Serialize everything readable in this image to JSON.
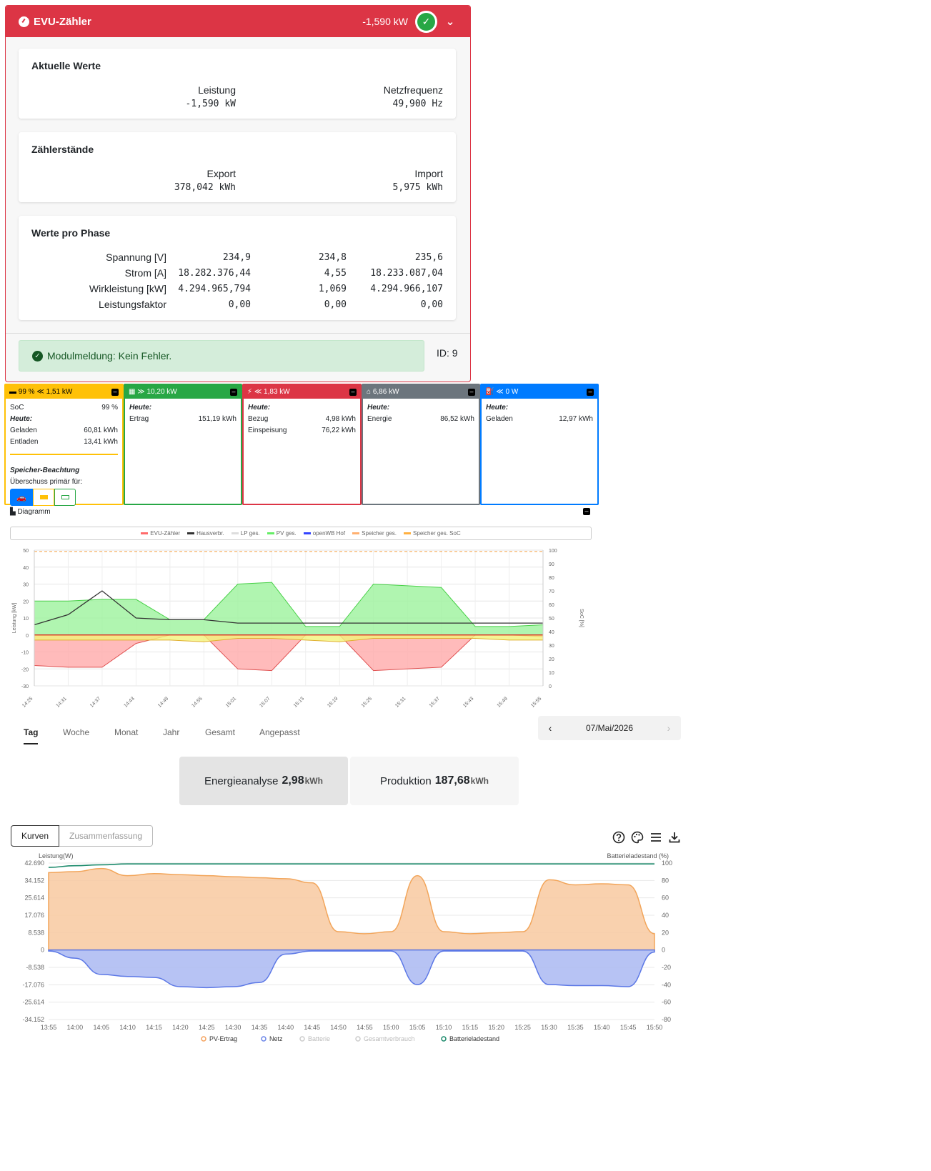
{
  "evu": {
    "title": "EVU-Zähler",
    "power": "-1,590 kW",
    "current": {
      "title": "Aktuelle Werte",
      "leistung_label": "Leistung",
      "leistung_value": "-1,590 kW",
      "freq_label": "Netzfrequenz",
      "freq_value": "49,900 Hz"
    },
    "counters": {
      "title": "Zählerstände",
      "export_label": "Export",
      "export_value": "378,042 kWh",
      "import_label": "Import",
      "import_value": "5,975 kWh"
    },
    "phases": {
      "title": "Werte pro Phase",
      "rows": [
        {
          "label": "Spannung [V]",
          "v": [
            "234,9",
            "234,8",
            "235,6"
          ]
        },
        {
          "label": "Strom [A]",
          "v": [
            "18.282.376,44",
            "4,55",
            "18.233.087,04"
          ]
        },
        {
          "label": "Wirkleistung [kW]",
          "v": [
            "4.294.965,794",
            "1,069",
            "4.294.966,107"
          ]
        },
        {
          "label": "Leistungsfaktor",
          "v": [
            "0,00",
            "0,00",
            "0,00"
          ]
        }
      ]
    },
    "message": "Modulmeldung: Kein Fehler.",
    "id": "ID: 9"
  },
  "status_cards": {
    "battery": {
      "header": "99 % ≪ 1,51 kW",
      "soc_label": "SoC",
      "soc_value": "99 %",
      "today": "Heute:",
      "charged_label": "Geladen",
      "charged_value": "60,81 kWh",
      "discharged_label": "Entladen",
      "discharged_value": "13,41 kWh",
      "note_title": "Speicher-Beachtung",
      "note_text": "Überschuss primär für:"
    },
    "pv": {
      "header": "≫ 10,20 kW",
      "today": "Heute:",
      "yield_label": "Ertrag",
      "yield_value": "151,19 kWh"
    },
    "grid": {
      "header": "≪ 1,83 kW",
      "today": "Heute:",
      "buy_label": "Bezug",
      "buy_value": "4,98 kWh",
      "feed_label": "Einspeisung",
      "feed_value": "76,22 kWh"
    },
    "house": {
      "header": "6,86 kW",
      "today": "Heute:",
      "energy_label": "Energie",
      "energy_value": "86,52 kWh"
    },
    "charge": {
      "header": "≪ 0 W",
      "today": "Heute:",
      "charged_label": "Geladen",
      "charged_value": "12,97 kWh"
    }
  },
  "colors": {
    "evu_red": "#dc3545",
    "battery_yellow": "#ffc107",
    "pv_green": "#28a745",
    "house_gray": "#6c757d",
    "charge_blue": "#007bff"
  },
  "diagram": {
    "title": "Diagramm",
    "legend": [
      "EVU-Zähler",
      "Hausverbr.",
      "LP ges.",
      "PV ges.",
      "openWB Hof",
      "Speicher ges.",
      "Speicher ges. SoC"
    ],
    "legend_colors": [
      "#ff6b6b",
      "#333333",
      "#dddddd",
      "#66ee66",
      "#3344ff",
      "#ffb070",
      "#ffb040"
    ],
    "ylabel_left": "Leistung [kW]",
    "ylabel_right": "SoC [%]",
    "yticks_left": [
      "50",
      "40",
      "30",
      "20",
      "10",
      "0",
      "-10",
      "-20",
      "-30"
    ],
    "yticks_right": [
      "100",
      "90",
      "80",
      "70",
      "60",
      "50",
      "40",
      "30",
      "20",
      "10",
      "0"
    ],
    "xticks": [
      "14:25",
      "14:31",
      "14:37",
      "14:43",
      "14:49",
      "14:55",
      "15:01",
      "15:07",
      "15:13",
      "15:19",
      "15:25",
      "15:31",
      "15:37",
      "15:43",
      "15:49",
      "15:55"
    ]
  },
  "chart_data": [
    {
      "type": "area",
      "ylabel": "Leistung [kW]",
      "ylabel_right": "SoC [%]",
      "ylim": [
        -30,
        50
      ],
      "ylim_right": [
        0,
        100
      ],
      "x": [
        "14:25",
        "14:31",
        "14:37",
        "14:43",
        "14:49",
        "14:55",
        "15:01",
        "15:07",
        "15:13",
        "15:19",
        "15:25",
        "15:31",
        "15:37",
        "15:43",
        "15:49",
        "15:55"
      ],
      "series": [
        {
          "name": "PV ges.",
          "values": [
            20,
            20,
            21,
            21,
            9,
            9,
            30,
            31,
            5,
            5,
            30,
            29,
            28,
            5,
            5,
            6
          ]
        },
        {
          "name": "EVU-Zähler",
          "values": [
            -18,
            -19,
            -19,
            -5,
            0,
            0,
            -20,
            -21,
            0,
            0,
            -21,
            -20,
            -19,
            0,
            0,
            -1
          ]
        },
        {
          "name": "Hausverbr.",
          "values": [
            6,
            12,
            26,
            10,
            9,
            9,
            7,
            7,
            7,
            7,
            7,
            7,
            7,
            7,
            7,
            7
          ]
        },
        {
          "name": "Speicher ges.",
          "values": [
            -3,
            -3,
            -3,
            -3,
            -3,
            -4,
            -2,
            -2,
            -3,
            -4,
            -2,
            -2,
            -2,
            -2,
            -3,
            -3
          ]
        },
        {
          "name": "Speicher ges. SoC",
          "values": [
            99,
            99,
            99,
            99,
            99,
            99,
            99,
            99,
            99,
            99,
            99,
            99,
            99,
            99,
            99,
            99
          ]
        }
      ]
    },
    {
      "type": "area",
      "ylabel": "Leistung(W)",
      "ylabel_right": "Batterieladestand (%)",
      "ylim": [
        -34152,
        42690
      ],
      "ylim_right": [
        -80,
        100
      ],
      "x": [
        "13:55",
        "14:00",
        "14:05",
        "14:10",
        "14:15",
        "14:20",
        "14:25",
        "14:30",
        "14:35",
        "14:40",
        "14:45",
        "14:50",
        "14:55",
        "15:00",
        "15:05",
        "15:10",
        "15:15",
        "15:20",
        "15:25",
        "15:30",
        "15:35",
        "15:40",
        "15:45",
        "15:50"
      ],
      "series": [
        {
          "name": "PV-Ertrag",
          "values": [
            38000,
            38500,
            40000,
            36500,
            37500,
            37000,
            36500,
            36000,
            35500,
            35000,
            33000,
            9000,
            8000,
            9000,
            36500,
            9000,
            8000,
            8500,
            9000,
            34500,
            32000,
            32500,
            32000,
            8000
          ]
        },
        {
          "name": "Netz",
          "values": [
            -500,
            -4000,
            -12000,
            -13000,
            -13500,
            -18000,
            -18500,
            -18000,
            -16000,
            -2000,
            -500,
            -500,
            -500,
            -500,
            -17000,
            -500,
            -500,
            -500,
            -500,
            -17000,
            -17500,
            -17500,
            -18000,
            -1000
          ]
        },
        {
          "name": "Batterieladestand",
          "values": [
            95,
            97,
            98,
            99,
            99,
            99,
            99,
            99,
            99,
            99,
            99,
            99,
            99,
            99,
            99,
            99,
            99,
            99,
            99,
            99,
            99,
            99,
            99,
            99
          ]
        }
      ]
    }
  ],
  "period_tabs": [
    "Tag",
    "Woche",
    "Monat",
    "Jahr",
    "Gesamt",
    "Angepasst"
  ],
  "date": "07/Mai/2026",
  "summary": {
    "energy_label": "Energieanalyse",
    "energy_value": "2,98",
    "energy_unit": "kWh",
    "prod_label": "Produktion",
    "prod_value": "187,68",
    "prod_unit": "kWh"
  },
  "view_buttons": [
    "Kurven",
    "Zusammenfassung"
  ],
  "chart2": {
    "ylabel": "Leistung(W)",
    "ylabel_right": "Batterieladestand (%)",
    "yticks_left": [
      "42.690",
      "34.152",
      "25.614",
      "17.076",
      "8.538",
      "0",
      "-8.538",
      "-17.076",
      "-25.614",
      "-34.152"
    ],
    "yticks_right": [
      "100",
      "80",
      "60",
      "40",
      "20",
      "0",
      "-20",
      "-40",
      "-60",
      "-80"
    ],
    "legend": [
      "PV-Ertrag",
      "Netz",
      "Batterie",
      "Gesamtverbrauch",
      "Batterieladestand"
    ],
    "legend_colors": [
      "#f5a25d",
      "#6a85e8",
      "#cccccc",
      "#cccccc",
      "#1b8a6b"
    ]
  },
  "icons": [
    "help-icon",
    "palette-icon",
    "menu-icon",
    "download-icon",
    "gauge-icon",
    "check-circle-icon",
    "chevron-down-icon"
  ]
}
